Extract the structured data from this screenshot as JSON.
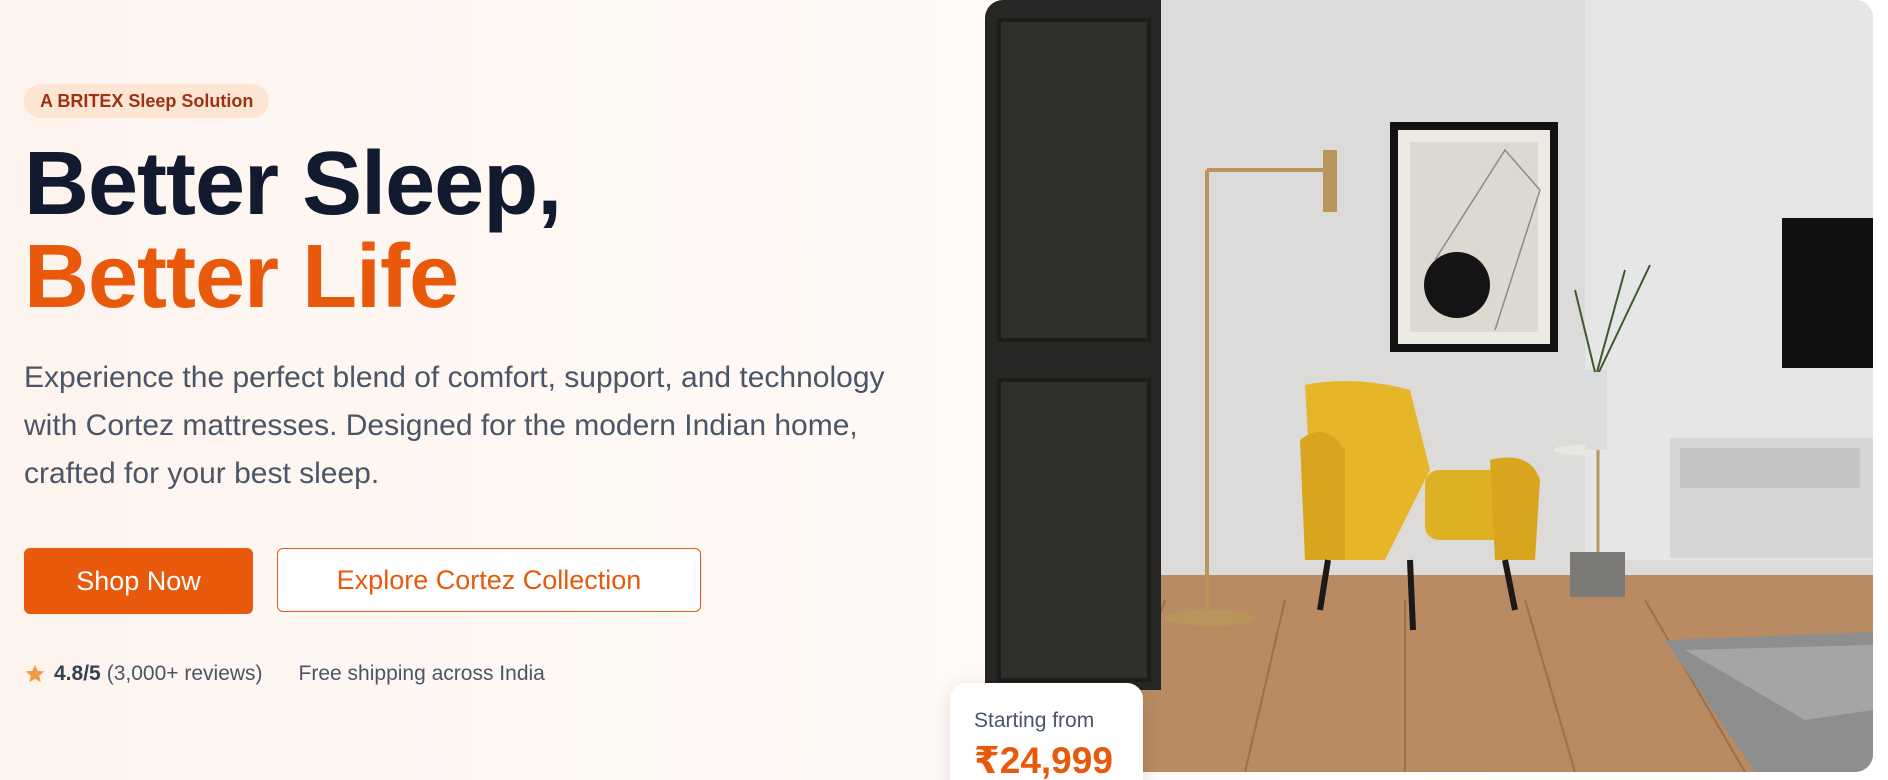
{
  "hero": {
    "tag": "A BRITEX Sleep Solution",
    "headline_line1": "Better Sleep,",
    "headline_line2": "Better Life",
    "description": "Experience the perfect blend of comfort, support, and technology with Cortez mattresses. Designed for the modern Indian home, crafted for your best sleep.",
    "primary_cta": "Shop Now",
    "secondary_cta": "Explore Cortez Collection",
    "rating": "4.8/5",
    "reviews": "(3,000+ reviews)",
    "shipping": "Free shipping across India"
  },
  "price_card": {
    "label": "Starting from",
    "value": "₹24,999"
  },
  "icons": {
    "rating": "star-icon"
  },
  "colors": {
    "accent": "#e8590c",
    "heading": "#111a2e",
    "body_text": "#4a5568",
    "tag_bg": "#fde5d3",
    "star": "#f2994a"
  }
}
